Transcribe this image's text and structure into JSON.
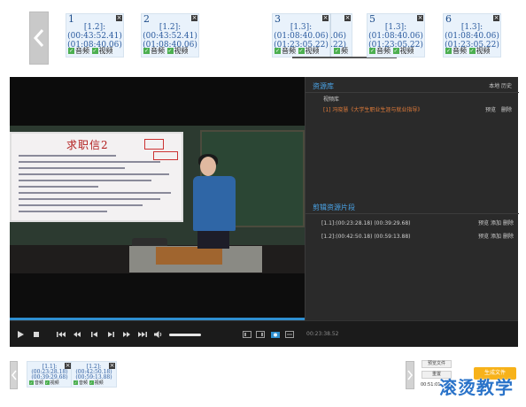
{
  "top_clips": [
    {
      "number": "1",
      "line1": "[1.2]:",
      "line2": "(00:43:52.41)",
      "line3": "(01:08:40.06)",
      "audio": "音频",
      "video": "视频"
    },
    {
      "number": "2",
      "line1": "[1.2]:",
      "line2": "(00:43:52.41)",
      "line3": "(01:08:40.06)",
      "audio": "音频",
      "video": "视频"
    },
    {
      "number": "3",
      "line1": "[1.3]:",
      "line2": "(01:08:40.06)",
      "line3": "(01:23:05.22)",
      "audio": "音频",
      "video": "视频"
    },
    {
      "number": "4",
      "line1": "",
      "line2": ".06)",
      "line3": ".22)",
      "audio": "",
      "video": "频"
    },
    {
      "number": "5",
      "line1": "[1.3]:",
      "line2": "(01:08:40.06)",
      "line3": "(01:23:05.22)",
      "audio": "音频",
      "video": "视频"
    },
    {
      "number": "6",
      "line1": "[1.3]:",
      "line2": "(01:08:40.06)",
      "line3": "(01:23:05.22)",
      "audio": "音频",
      "video": "视频"
    }
  ],
  "video_slide": {
    "title": "求职信2"
  },
  "resource_panel": {
    "title": "资源库",
    "header_right": "本地 历史",
    "category": "视频库",
    "item_text": "[1] 冯晓慧《大学生职业生涯与就业指导》",
    "item_preview": "预览",
    "item_delete": "删除"
  },
  "clips_panel": {
    "title": "剪辑资源片段",
    "items": [
      {
        "text": "[1.1]:(00:23:28.18) (00:39:29.68)",
        "preview": "预览",
        "add": "添加",
        "delete": "删除"
      },
      {
        "text": "[1.2]:(00:42:50.18) (00:59:13.88)",
        "preview": "预览",
        "add": "添加",
        "delete": "删除"
      }
    ]
  },
  "player": {
    "time": "00:23:38.52",
    "progress_fraction": 0.0
  },
  "bottom_clips": [
    {
      "line1": "[1.1]:",
      "line2": "(00:23:28.18)",
      "line3": "(00:39:29.68)",
      "audio": "音频",
      "video": "视频"
    },
    {
      "line1": "[1.2]:",
      "line2": "(00:42:50.18)",
      "line3": "(00:59:13.88)",
      "audio": "音频",
      "video": "视频"
    }
  ],
  "bottom_bar": {
    "button_top": "预览文件",
    "button_mid": "重置",
    "time_text": "00:51:01",
    "merge_button": "生成文件"
  },
  "watermark": "滚烫教学",
  "colors": {
    "accent_blue": "#4aa3e6",
    "progress": "#2e8fd0",
    "orange": "#f7b21a",
    "link_orange": "#e07b3a"
  }
}
